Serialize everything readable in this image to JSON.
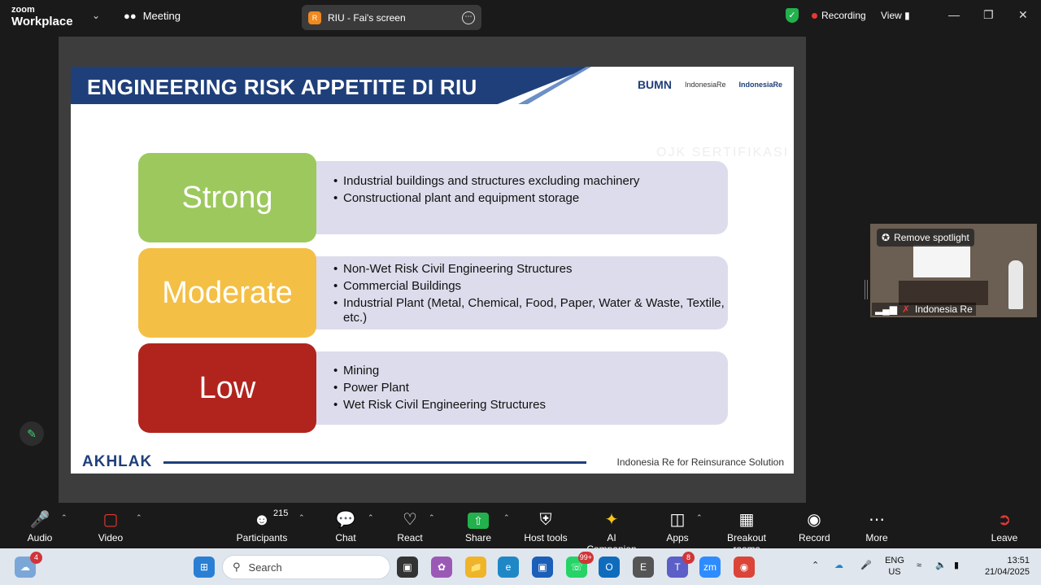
{
  "titlebar": {
    "brand_line1": "zoom",
    "brand_line2": "Workplace",
    "meeting_label": "Meeting",
    "shared_screen_title": "RIU - Fai's screen",
    "shared_screen_avatar": "R",
    "recording_label": "Recording",
    "view_label": "View"
  },
  "slide": {
    "title": "ENGINEERING RISK APPETITE DI RIU",
    "logo_bumn": "BUMN",
    "logo_indonesia_re": "IndonesiaRe",
    "logo_institute": "IndonesiaRe",
    "watermark": "OJK SERTIFIKASI",
    "rows": [
      {
        "label": "Strong",
        "color": "#9dc85e",
        "items": [
          "Industrial buildings and structures excluding machinery",
          "Constructional plant and equipment storage"
        ]
      },
      {
        "label": "Moderate",
        "color": "#f4bf45",
        "items": [
          "Non-Wet Risk Civil Engineering Structures",
          "Commercial Buildings",
          "Industrial Plant (Metal, Chemical, Food, Paper, Water & Waste, Textile, etc.)"
        ]
      },
      {
        "label": "Low",
        "color": "#b1241e",
        "items": [
          "Mining",
          "Power Plant",
          "Wet Risk Civil Engineering Structures"
        ]
      }
    ],
    "footer_left": "AKHLAK",
    "footer_right": "Indonesia Re for Reinsurance Solution"
  },
  "thumbnail": {
    "remove_spotlight": "Remove spotlight",
    "participant_name": "Indonesia Re"
  },
  "toolbar": {
    "audio": "Audio",
    "video": "Video",
    "participants": "Participants",
    "participants_count": "215",
    "chat": "Chat",
    "react": "React",
    "share": "Share",
    "host_tools": "Host tools",
    "ai_companion": "AI Companion",
    "apps": "Apps",
    "breakout_rooms": "Breakout rooms",
    "record": "Record",
    "more": "More",
    "leave": "Leave"
  },
  "taskbar": {
    "weather_badge": "4",
    "search_placeholder": "Search",
    "whatsapp_badge": "99+",
    "teams_badge": "8",
    "language_line1": "ENG",
    "language_line2": "US",
    "time": "13:51",
    "date": "21/04/2025"
  }
}
